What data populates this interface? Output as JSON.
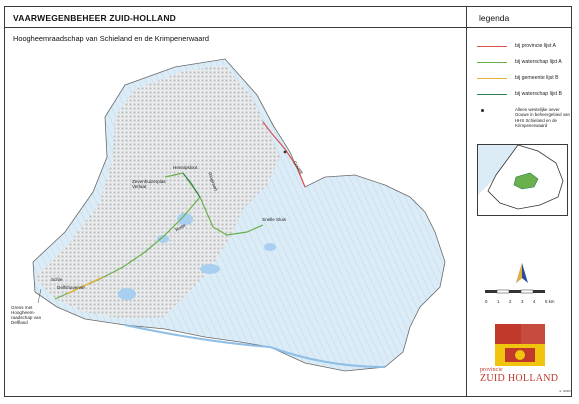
{
  "map": {
    "title": "VAARWEGENBEHEER ZUID-HOLLAND",
    "subtitle": "Hoogheemraadschap van Schieland en de Krimpenerwaard",
    "place_labels": {
      "zevenhuizerplas": "Zevenhuizerplas Verlaat",
      "hennipsloot": "Hennipsloot",
      "rotte": "Rotte",
      "schie": "Schie",
      "delfshavense": "Delfshavense",
      "gouwe": "Gouwe",
      "ringvaart": "Ringvaart",
      "boezem": "Boezem",
      "grens_delfland": "Grens met Hoogheem-raadschap van Delfland",
      "ssluis": "Snelle Sluis"
    },
    "colors": {
      "water_background": "#dcecf7",
      "urban": "#b9b9b9",
      "provincie_lijst_a": "#d9534f",
      "waterschap_lijst_a": "#6ab04c",
      "gemeente_lijst_b": "#e2b13c",
      "waterschap_lijst_b": "#2e7d4f"
    }
  },
  "legend": {
    "title": "legenda",
    "items": [
      {
        "label": "bij provincie lijst A",
        "color": "#d9534f"
      },
      {
        "label": "bij waterschap  lijst A",
        "color": "#6ab04c"
      },
      {
        "label": "bij gemeente lijst B",
        "color": "#e2b13c"
      },
      {
        "label": "bij waterschap lijst B",
        "color": "#2e7d4f"
      }
    ],
    "note": "Alleen westelijke oever Gouwe in beheergebied van HHS Schieland en de Krimpenerwaard",
    "scale_labels": [
      "0",
      "1",
      "2",
      "3",
      "4",
      "5 km"
    ],
    "north_label": "N",
    "logo_line1": "provincie",
    "logo_line2": "ZUID HOLLAND",
    "code": "nr. 00000"
  }
}
